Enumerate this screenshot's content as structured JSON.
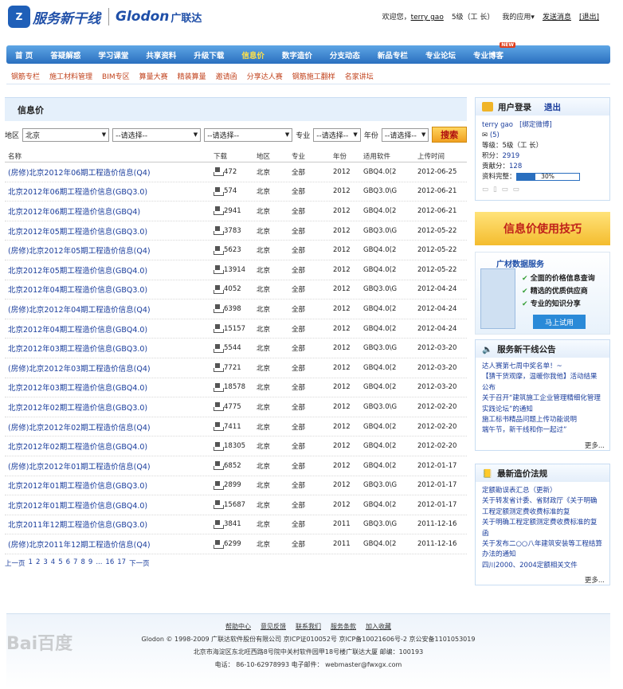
{
  "logo": {
    "badge": "Z",
    "cn": "服务新干线",
    "glodon": "Glodon",
    "cn2": "广联达"
  },
  "userbar": {
    "welcome": "欢迎您，",
    "user": "terry gao",
    "level": "5级（工 长）",
    "my_app": "我的应用▾",
    "send_msg": "发送消息",
    "logout": "[退出]"
  },
  "nav": [
    "首 页",
    "答疑解惑",
    "学习课堂",
    "共享资料",
    "升级下载",
    "信息价",
    "数字造价",
    "分支动态",
    "新品专栏",
    "专业论坛",
    "专业博客"
  ],
  "nav_active": "信息价",
  "nav_hot": "NEW",
  "subnav": [
    "钢筋专栏",
    "施工材料管理",
    "BIM专区",
    "算量大赛",
    "精装算量",
    "邀请函",
    "分享达人赛",
    "钢筋施工翻样",
    "名家讲坛"
  ],
  "section_title": "信息价",
  "filters": {
    "area_label": "地区",
    "area_value": "北京",
    "select_placeholder": "--请选择--",
    "prof_label": "专业",
    "year_label": "年份",
    "search_btn": "搜索"
  },
  "table": {
    "headers": [
      "名称",
      "下载",
      "地区",
      "专业",
      "年份",
      "适用软件",
      "上传时间"
    ],
    "rows": [
      {
        "name": "(房修)北京2012年06期工程造价信息(Q4)",
        "dl": "472",
        "area": "北京",
        "prof": "全部",
        "year": "2012",
        "soft": "GBQ4.0(2",
        "date": "2012-06-25"
      },
      {
        "name": "北京2012年06期工程造价信息(GBQ3.0)",
        "dl": "574",
        "area": "北京",
        "prof": "全部",
        "year": "2012",
        "soft": "GBQ3.0\\G",
        "date": "2012-06-21"
      },
      {
        "name": "北京2012年06期工程造价信息(GBQ4)",
        "dl": "2941",
        "area": "北京",
        "prof": "全部",
        "year": "2012",
        "soft": "GBQ4.0(2",
        "date": "2012-06-21"
      },
      {
        "name": "北京2012年05期工程造价信息(GBQ3.0)",
        "dl": "3783",
        "area": "北京",
        "prof": "全部",
        "year": "2012",
        "soft": "GBQ3.0\\G",
        "date": "2012-05-22"
      },
      {
        "name": "(房修)北京2012年05期工程造价信息(Q4)",
        "dl": "5623",
        "area": "北京",
        "prof": "全部",
        "year": "2012",
        "soft": "GBQ4.0(2",
        "date": "2012-05-22"
      },
      {
        "name": "北京2012年05期工程造价信息(GBQ4.0)",
        "dl": "13914",
        "area": "北京",
        "prof": "全部",
        "year": "2012",
        "soft": "GBQ4.0(2",
        "date": "2012-05-22"
      },
      {
        "name": "北京2012年04期工程造价信息(GBQ3.0)",
        "dl": "4052",
        "area": "北京",
        "prof": "全部",
        "year": "2012",
        "soft": "GBQ3.0\\G",
        "date": "2012-04-24"
      },
      {
        "name": "(房修)北京2012年04期工程造价信息(Q4)",
        "dl": "6398",
        "area": "北京",
        "prof": "全部",
        "year": "2012",
        "soft": "GBQ4.0(2",
        "date": "2012-04-24"
      },
      {
        "name": "北京2012年04期工程造价信息(GBQ4.0)",
        "dl": "15157",
        "area": "北京",
        "prof": "全部",
        "year": "2012",
        "soft": "GBQ4.0(2",
        "date": "2012-04-24"
      },
      {
        "name": "北京2012年03期工程造价信息(GBQ3.0)",
        "dl": "5544",
        "area": "北京",
        "prof": "全部",
        "year": "2012",
        "soft": "GBQ3.0\\G",
        "date": "2012-03-20"
      },
      {
        "name": "(房修)北京2012年03期工程造价信息(Q4)",
        "dl": "7721",
        "area": "北京",
        "prof": "全部",
        "year": "2012",
        "soft": "GBQ4.0(2",
        "date": "2012-03-20"
      },
      {
        "name": "北京2012年03期工程造价信息(GBQ4.0)",
        "dl": "18578",
        "area": "北京",
        "prof": "全部",
        "year": "2012",
        "soft": "GBQ4.0(2",
        "date": "2012-03-20"
      },
      {
        "name": "北京2012年02期工程造价信息(GBQ3.0)",
        "dl": "4775",
        "area": "北京",
        "prof": "全部",
        "year": "2012",
        "soft": "GBQ3.0\\G",
        "date": "2012-02-20"
      },
      {
        "name": "(房修)北京2012年02期工程造价信息(Q4)",
        "dl": "7411",
        "area": "北京",
        "prof": "全部",
        "year": "2012",
        "soft": "GBQ4.0(2",
        "date": "2012-02-20"
      },
      {
        "name": "北京2012年02期工程造价信息(GBQ4.0)",
        "dl": "18305",
        "area": "北京",
        "prof": "全部",
        "year": "2012",
        "soft": "GBQ4.0(2",
        "date": "2012-02-20"
      },
      {
        "name": "(房修)北京2012年01期工程造价信息(Q4)",
        "dl": "6852",
        "area": "北京",
        "prof": "全部",
        "year": "2012",
        "soft": "GBQ4.0(2",
        "date": "2012-01-17"
      },
      {
        "name": "北京2012年01期工程造价信息(GBQ3.0)",
        "dl": "2899",
        "area": "北京",
        "prof": "全部",
        "year": "2012",
        "soft": "GBQ3.0\\G",
        "date": "2012-01-17"
      },
      {
        "name": "北京2012年01期工程造价信息(GBQ4.0)",
        "dl": "15687",
        "area": "北京",
        "prof": "全部",
        "year": "2012",
        "soft": "GBQ4.0(2",
        "date": "2012-01-17"
      },
      {
        "name": "北京2011年12期工程造价信息(GBQ3.0)",
        "dl": "3841",
        "area": "北京",
        "prof": "全部",
        "year": "2011",
        "soft": "GBQ3.0\\G",
        "date": "2011-12-16"
      },
      {
        "name": "(房修)北京2011年12期工程造价信息(Q4)",
        "dl": "6299",
        "area": "北京",
        "prof": "全部",
        "year": "2011",
        "soft": "GBQ4.0(2",
        "date": "2011-12-16"
      }
    ]
  },
  "pager": [
    "上一页",
    "1",
    "2",
    "3",
    "4",
    "5",
    "6",
    "7",
    "8",
    "9",
    "...",
    "16",
    "17",
    "下一页"
  ],
  "login": {
    "title": "用户登录",
    "logout": "退出",
    "user": "terry gao",
    "bind": "[绑定微博]",
    "mail_count": "(5)",
    "level_label": "等级：",
    "level": "5级（工 长）",
    "points_label": "积分：",
    "points": "2919",
    "contrib_label": "贡献分：",
    "contrib": "128",
    "complete_label": "资料完整：",
    "complete_pct": "30%",
    "complete_value": 0.3
  },
  "tips": "信息价使用技巧",
  "ad": {
    "title": "广材数据服务",
    "items": [
      "全面的价格信息查询",
      "精选的优质供应商",
      "专业的知识分享"
    ],
    "button": "马上试用"
  },
  "notice": {
    "title": "服务新干线公告",
    "items": [
      "达人赛第七周中奖名单！~",
      "【猜干货观摩，温暖你我他】活动结果公布",
      "关于召开“建筑施工企业管理精细化管理实践论坛”的通知",
      "施工标书精品问题上传功能说明",
      "端午节，新干线和你一起过”"
    ],
    "more": "更多..."
  },
  "law": {
    "title": "最新造价法规",
    "items": [
      "定额勘误表汇总（更新）",
      "关于转发省计委、省财政厅《关于明确工程定额测定费收费标准的复",
      "关于明确工程定额测定费收费标准的复函",
      "关于发布二○○八年建筑安装等工程结算办法的通知",
      "四川2000、2004定额相关文件"
    ],
    "more": "更多..."
  },
  "footer": {
    "links": [
      "帮助中心",
      "意见反馈",
      "联系我们",
      "服务条款",
      "加入收藏"
    ],
    "line1": "Glodon © 1998-2009      广联达软件股份有限公司 京ICP证010052号 京ICP备10021606号-2 京公安备1101053019",
    "line2": "北京市海淀区东北旺西路8号院中关村软件园甲18号楼广联达大厦      邮编：100193",
    "line3": "电话： 86-10-62978993       电子邮件： webmaster@fwxgx.com"
  },
  "watermark": "Bai百度"
}
